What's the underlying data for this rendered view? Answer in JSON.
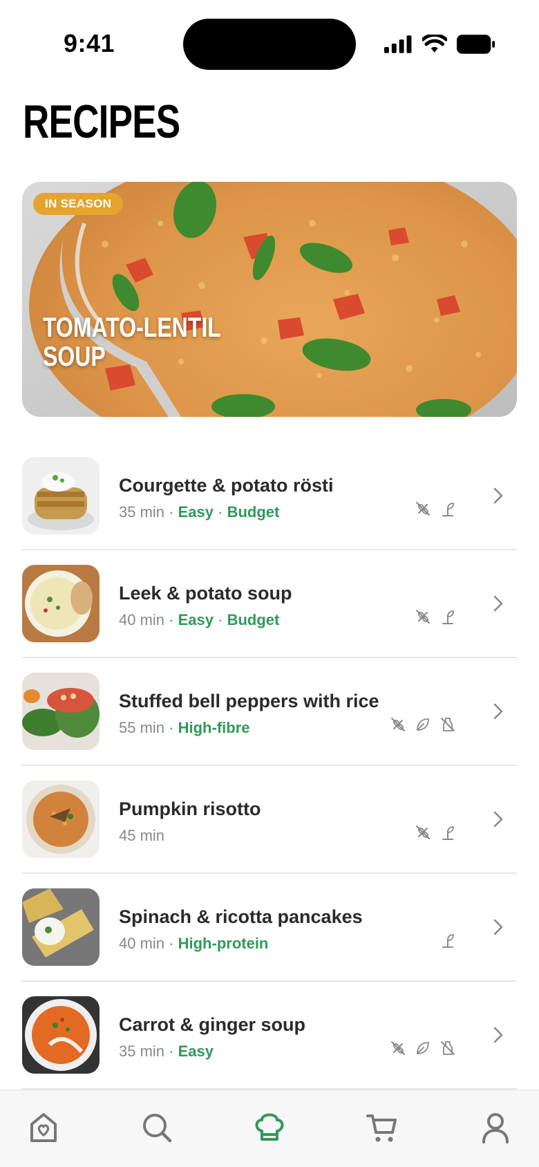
{
  "status_bar": {
    "time": "9:41"
  },
  "page_title": "RECIPES",
  "hero": {
    "badge": "IN SEASON",
    "title": "TOMATO-LENTIL SOUP"
  },
  "recipes": [
    {
      "name": "Courgette & potato rösti",
      "time": "35 min",
      "tags": [
        "Easy",
        "Budget"
      ],
      "diet_icons": [
        "gluten-free-icon",
        "vegetarian-icon"
      ]
    },
    {
      "name": "Leek & potato soup",
      "time": "40 min",
      "tags": [
        "Easy",
        "Budget"
      ],
      "diet_icons": [
        "gluten-free-icon",
        "vegetarian-icon"
      ]
    },
    {
      "name": "Stuffed bell peppers with rice",
      "time": "55 min",
      "tags": [
        "High-fibre"
      ],
      "diet_icons": [
        "gluten-free-icon",
        "vegan-icon",
        "dairy-free-icon"
      ]
    },
    {
      "name": "Pumpkin risotto",
      "time": "45 min",
      "tags": [],
      "diet_icons": [
        "gluten-free-icon",
        "vegetarian-icon"
      ]
    },
    {
      "name": "Spinach & ricotta pancakes",
      "time": "40 min",
      "tags": [
        "High-protein"
      ],
      "diet_icons": [
        "vegetarian-icon"
      ]
    },
    {
      "name": "Carrot & ginger soup",
      "time": "35 min",
      "tags": [
        "Easy"
      ],
      "diet_icons": [
        "gluten-free-icon",
        "vegan-icon",
        "dairy-free-icon"
      ]
    }
  ],
  "tab_bar": {
    "tabs": [
      "home-icon",
      "search-icon",
      "recipes-icon",
      "cart-icon",
      "profile-icon"
    ],
    "active": "recipes-icon"
  },
  "colors": {
    "accent_green": "#2f9a5a",
    "badge_orange": "#e6a32e",
    "muted_text": "#888888"
  }
}
